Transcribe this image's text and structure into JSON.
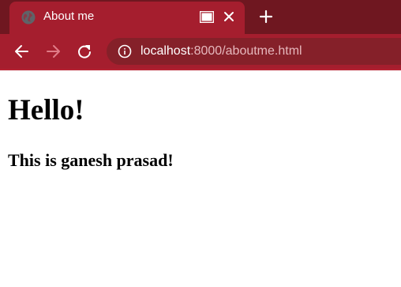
{
  "browser": {
    "tab": {
      "title": "About me",
      "favicon": "globe-icon"
    },
    "new_tab_icon": "plus-icon",
    "toolbar": {
      "back_icon": "back-arrow-icon",
      "forward_icon": "forward-arrow-icon",
      "reload_icon": "reload-icon",
      "site_info_icon": "info-icon",
      "url_host": "localhost",
      "url_rest": ":8000/aboutme.html"
    },
    "colors": {
      "frame": "#6f1720",
      "tab_active": "#a51e2e",
      "omnibox": "#852029",
      "url_dim": "#e6b8bd"
    }
  },
  "page": {
    "heading": "Hello!",
    "subheading": "This is ganesh prasad!"
  }
}
